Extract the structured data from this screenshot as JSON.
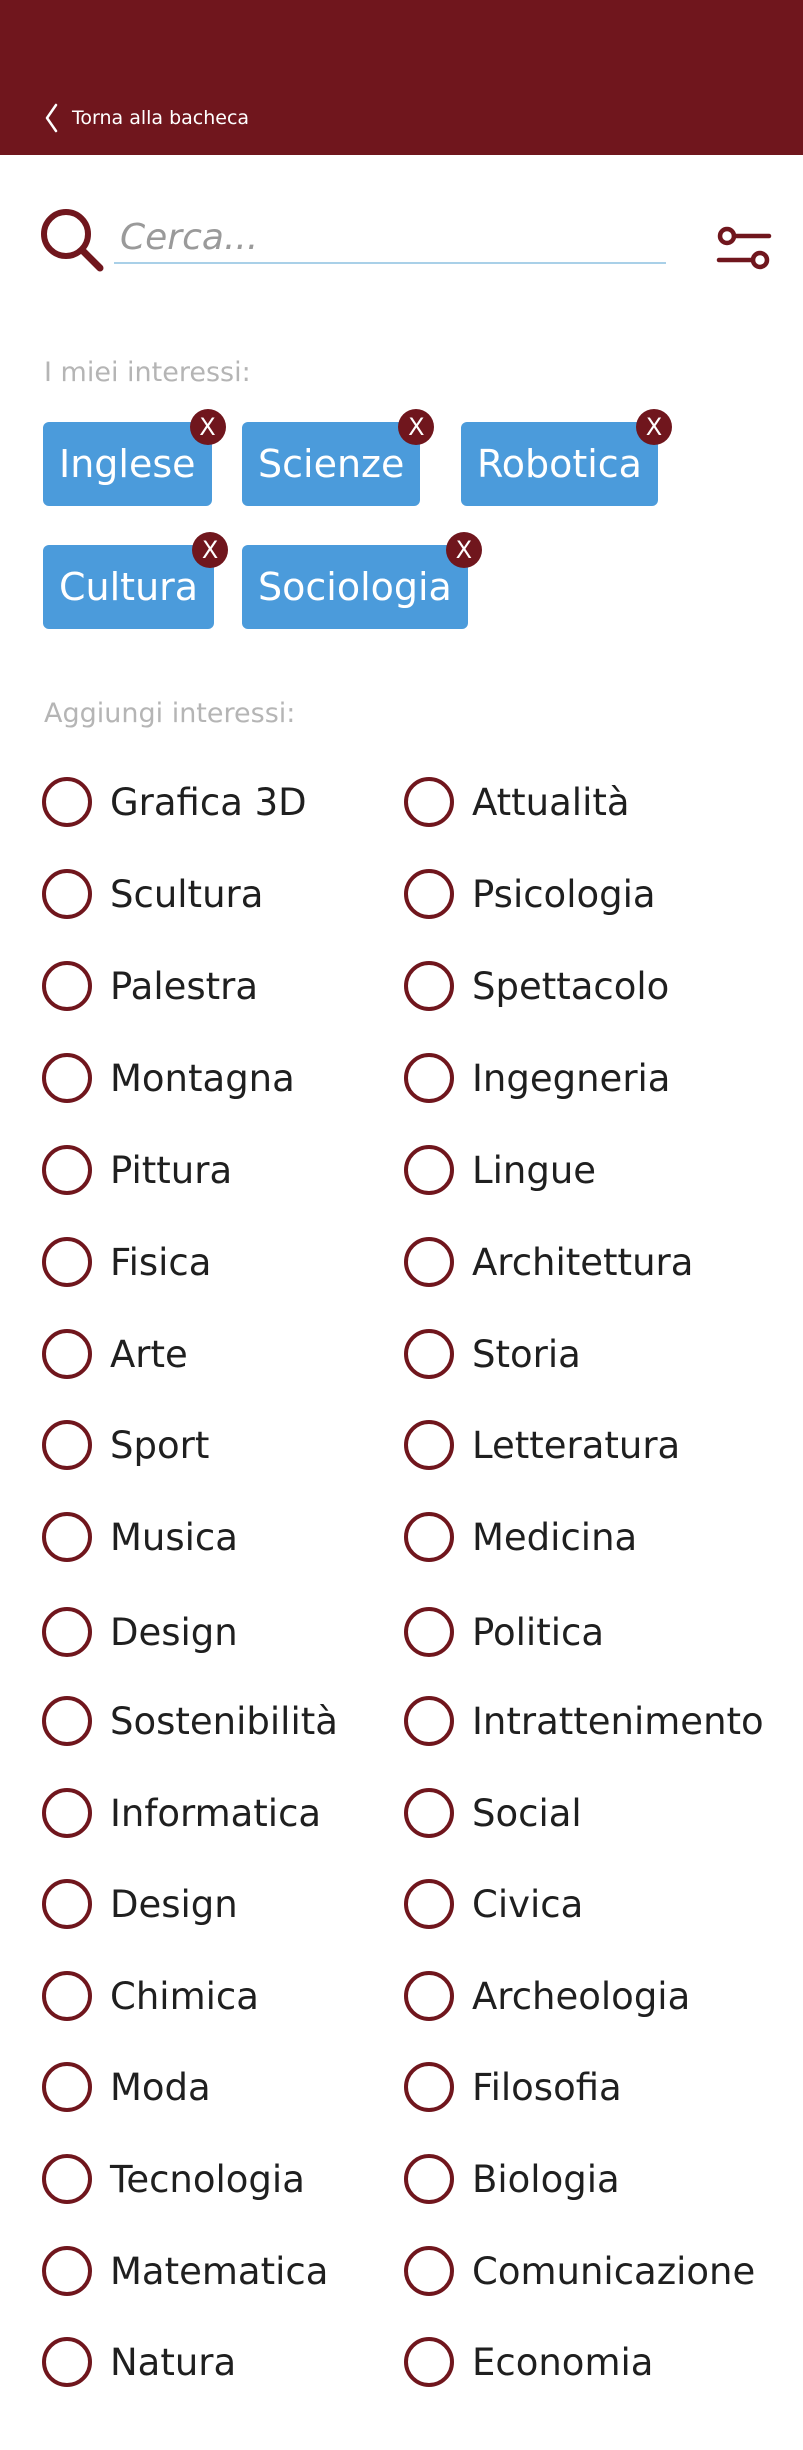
{
  "header": {
    "back_label": "Torna alla bacheca"
  },
  "search": {
    "placeholder": "Cerca..."
  },
  "interests": {
    "title": "I miei interessi:",
    "chips": [
      {
        "label": "Inglese",
        "remove": "X"
      },
      {
        "label": "Scienze",
        "remove": "X"
      },
      {
        "label": "Robotica",
        "remove": "X"
      },
      {
        "label": "Cultura",
        "remove": "X"
      },
      {
        "label": "Sociologia",
        "remove": "X"
      }
    ]
  },
  "add": {
    "title": "Aggiungi interessi:",
    "left": [
      "Grafica 3D",
      "Scultura",
      "Palestra",
      "Montagna",
      "Pittura",
      "Fisica",
      "Arte",
      "Sport",
      "Musica",
      "Design",
      "Sostenibilità",
      "Informatica",
      "Design",
      "Chimica",
      "Moda",
      "Tecnologia",
      "Matematica",
      "Natura"
    ],
    "right": [
      "Attualità",
      "Psicologia",
      "Spettacolo",
      "Ingegneria",
      "Lingue",
      "Architettura",
      "Storia",
      "Letteratura",
      "Medicina",
      "Politica",
      "Intrattenimento",
      "Social",
      "Civica",
      "Archeologia",
      "Filosofia",
      "Biologia",
      "Comunicazione",
      "Economia"
    ]
  },
  "colors": {
    "primary": "#70161d",
    "chip": "#4b9bdb",
    "search_underline": "#a9d0e8"
  }
}
